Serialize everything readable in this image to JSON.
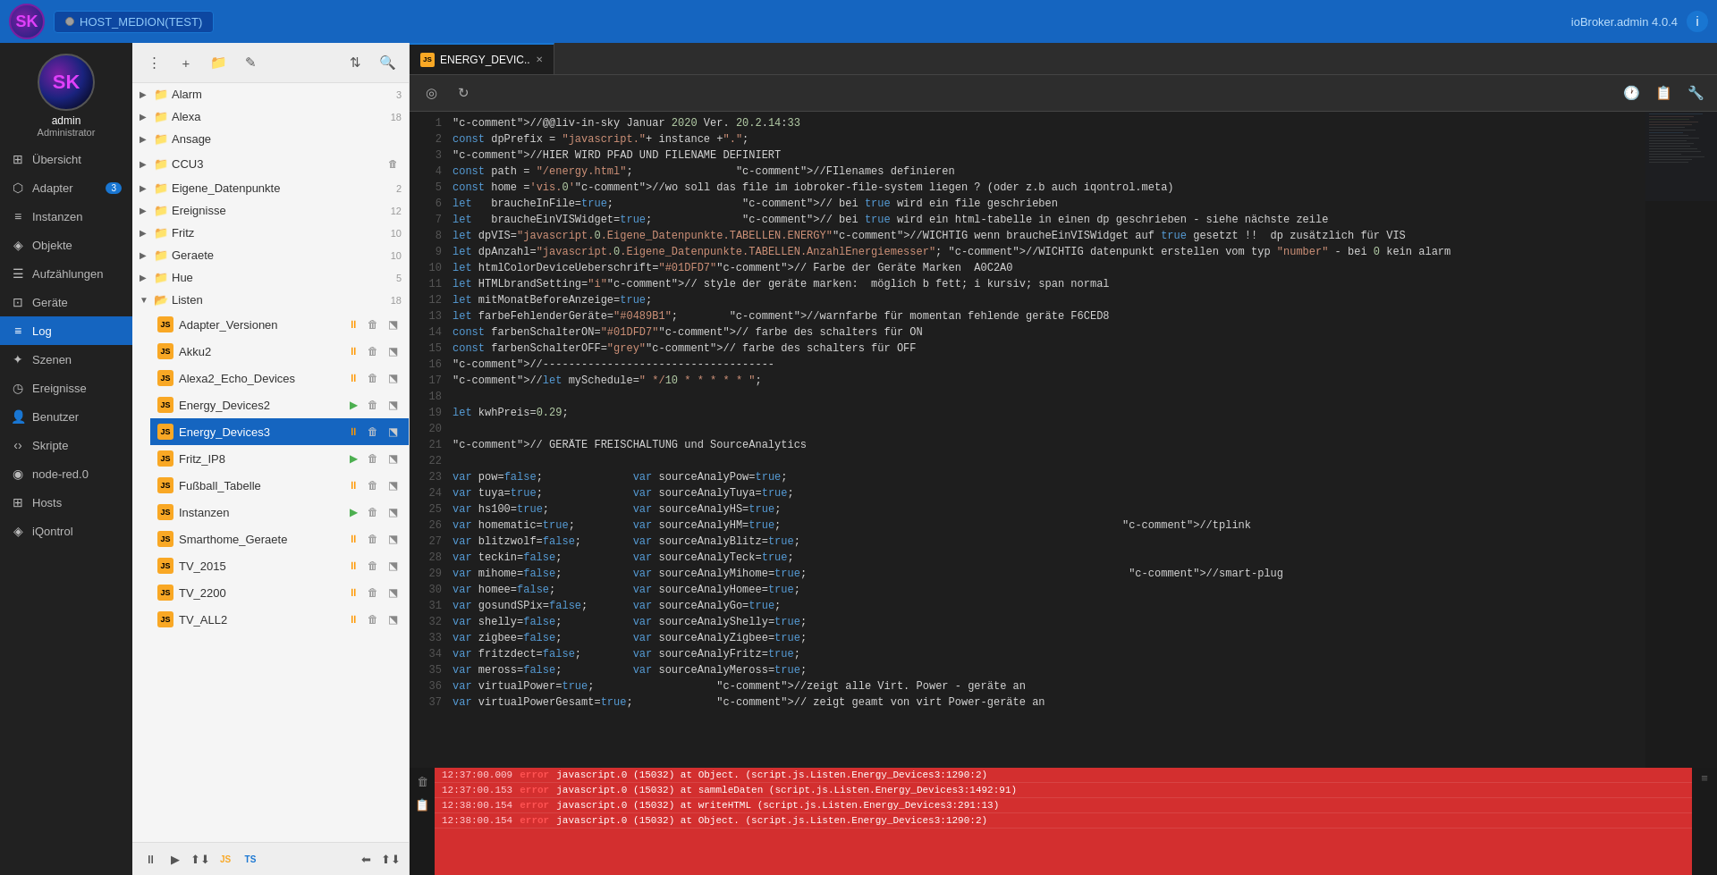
{
  "topbar": {
    "logo": "SK",
    "host_label": "HOST_MEDION(TEST)",
    "user_label": "ioBroker.admin 4.0.4",
    "icon_label": "i"
  },
  "sidebar": {
    "avatar_initials": "SK",
    "avatar_name": "admin",
    "avatar_role": "Administrator",
    "items": [
      {
        "id": "uebersicht",
        "label": "Übersicht",
        "icon": "⊞",
        "badge": null
      },
      {
        "id": "adapter",
        "label": "Adapter",
        "icon": "⬡",
        "badge": "3"
      },
      {
        "id": "instanzen",
        "label": "Instanzen",
        "icon": "≡",
        "badge": null
      },
      {
        "id": "objekte",
        "label": "Objekte",
        "icon": "◈",
        "badge": null
      },
      {
        "id": "aufzaehlungen",
        "label": "Aufzählungen",
        "icon": "☰",
        "badge": null
      },
      {
        "id": "geraete",
        "label": "Geräte",
        "icon": "⊡",
        "badge": null
      },
      {
        "id": "log",
        "label": "Log",
        "icon": "≡",
        "badge": null,
        "active": true
      },
      {
        "id": "szenen",
        "label": "Szenen",
        "icon": "✦",
        "badge": null
      },
      {
        "id": "ereignisse",
        "label": "Ereignisse",
        "icon": "◷",
        "badge": null
      },
      {
        "id": "benutzer",
        "label": "Benutzer",
        "icon": "👤",
        "badge": null
      },
      {
        "id": "skripte",
        "label": "Skripte",
        "icon": "‹›",
        "badge": null
      },
      {
        "id": "nodered",
        "label": "node-red.0",
        "icon": "◉",
        "badge": null
      },
      {
        "id": "hosts",
        "label": "Hosts",
        "icon": "⊞",
        "badge": null
      },
      {
        "id": "iqontrol",
        "label": "iQontrol",
        "icon": "◈",
        "badge": null
      }
    ]
  },
  "filetree": {
    "folders": [
      {
        "name": "Alarm",
        "count": "3",
        "expanded": false,
        "children": []
      },
      {
        "name": "Alexa",
        "count": "18",
        "expanded": false,
        "children": []
      },
      {
        "name": "Ansage",
        "count": "",
        "expanded": false,
        "children": []
      },
      {
        "name": "CCU3",
        "count": "",
        "expanded": false,
        "children": [],
        "has_delete": true
      },
      {
        "name": "Eigene_Datenpunkte",
        "count": "2",
        "expanded": false,
        "children": []
      },
      {
        "name": "Ereignisse",
        "count": "12",
        "expanded": false,
        "children": []
      },
      {
        "name": "Fritz",
        "count": "10",
        "expanded": false,
        "children": []
      },
      {
        "name": "Geraete",
        "count": "10",
        "expanded": false,
        "children": []
      },
      {
        "name": "Hue",
        "count": "5",
        "expanded": false,
        "children": []
      },
      {
        "name": "Listen",
        "count": "18",
        "expanded": true,
        "children": [
          {
            "name": "Adapter_Versionen",
            "type": "js",
            "status": "pause",
            "active": false
          },
          {
            "name": "Akku2",
            "type": "js",
            "status": "pause",
            "active": false
          },
          {
            "name": "Alexa2_Echo_Devices",
            "type": "js",
            "status": "pause",
            "active": false
          },
          {
            "name": "Energy_Devices2",
            "type": "js",
            "status": "play",
            "active": false
          },
          {
            "name": "Energy_Devices3",
            "type": "js",
            "status": "pause",
            "active": true
          },
          {
            "name": "Fritz_IP8",
            "type": "js",
            "status": "play",
            "active": false
          },
          {
            "name": "Fußball_Tabelle",
            "type": "js",
            "status": "pause",
            "active": false
          },
          {
            "name": "Instanzen",
            "type": "js",
            "status": "play",
            "active": false
          },
          {
            "name": "Smarthome_Geraete",
            "type": "js",
            "status": "pause",
            "active": false
          },
          {
            "name": "TV_2015",
            "type": "js",
            "status": "pause",
            "active": false
          },
          {
            "name": "TV_2200",
            "type": "js",
            "status": "pause",
            "active": false
          },
          {
            "name": "TV_ALL2",
            "type": "js",
            "status": "pause",
            "active": false
          }
        ]
      }
    ],
    "bottom_buttons": [
      "⏸",
      "▶",
      "⬆⬇",
      "JS",
      "TS"
    ]
  },
  "editor": {
    "tab_name": "ENERGY_DEVIC..",
    "toolbar_icons": [
      "◎",
      "↻"
    ],
    "right_icons": [
      "🕐",
      "📋",
      "🔧"
    ],
    "lines": [
      {
        "n": 1,
        "code": "//@@liv-in-sky Januar 2020 Ver. 20.2.14:33"
      },
      {
        "n": 2,
        "code": "const dpPrefix = \"javascript.\"+ instance +\".\";"
      },
      {
        "n": 3,
        "code": "    //HIER WIRD PFAD UND FILENAME DEFINIERT"
      },
      {
        "n": 4,
        "code": "const path = \"/energy.html\";                //FIlenames definieren"
      },
      {
        "n": 5,
        "code": "const home ='vis.0'                          //wo soll das file im iobroker-file-system liegen ? (oder z.b auch iqontrol.meta)"
      },
      {
        "n": 6,
        "code": "let   braucheInFile=true;                    // bei true wird ein file geschrieben"
      },
      {
        "n": 7,
        "code": "let   braucheEinVISWidget=true;              // bei true wird ein html-tabelle in einen dp geschrieben - siehe nächste zeile"
      },
      {
        "n": 8,
        "code": "let dpVIS=\"javascript.0.Eigene_Datenpunkte.TABELLEN.ENERGY\" //WICHTIG wenn braucheEinVISWidget auf true gesetzt !!  dp zusätzlich für VIS"
      },
      {
        "n": 9,
        "code": "let dpAnzahl=\"javascript.0.Eigene_Datenpunkte.TABELLEN.AnzahlEnergiemesser\"; //WICHTIG datenpunkt erstellen vom typ \"number\" - bei 0 kein alarm"
      },
      {
        "n": 10,
        "code": "let htmlColorDeviceUeberschrift=\"#01DFD7\"  // Farbe der Geräte Marken  A0C2A0"
      },
      {
        "n": 11,
        "code": "let HTMLbrandSetting=\"i\"                   // style der geräte marken:  möglich b fett; i kursiv; span normal"
      },
      {
        "n": 12,
        "code": "let mitMonatBeforeAnzeige=true;"
      },
      {
        "n": 13,
        "code": "let farbeFehlenderGeräte=\"#0489B1\";        //warnfarbe für momentan fehlende geräte F6CED8"
      },
      {
        "n": 14,
        "code": "const farbenSchalterON=\"#01DFD7\"           // farbe des schalters für ON"
      },
      {
        "n": 15,
        "code": "const farbenSchalterOFF=\"grey\"             // farbe des schalters für OFF"
      },
      {
        "n": 16,
        "code": "//------------------------------------"
      },
      {
        "n": 17,
        "code": "//let mySchedule=\" */10 * * * * * \";"
      },
      {
        "n": 18,
        "code": ""
      },
      {
        "n": 19,
        "code": "let kwhPreis=0.29;"
      },
      {
        "n": 20,
        "code": ""
      },
      {
        "n": 21,
        "code": "// GERÄTE FREISCHALTUNG und SourceAnalytics"
      },
      {
        "n": 22,
        "code": ""
      },
      {
        "n": 23,
        "code": "var pow=false;              var sourceAnalyPow=true;"
      },
      {
        "n": 24,
        "code": "var tuya=true;              var sourceAnalyTuya=true;"
      },
      {
        "n": 25,
        "code": "var hs100=true;             var sourceAnalyHS=true;"
      },
      {
        "n": 26,
        "code": "var homematic=true;         var sourceAnalyHM=true;                                                     //tplink"
      },
      {
        "n": 27,
        "code": "var blitzwolf=false;        var sourceAnalyBlitz=true;"
      },
      {
        "n": 28,
        "code": "var teckin=false;           var sourceAnalyTeck=true;"
      },
      {
        "n": 29,
        "code": "var mihome=false;           var sourceAnalyMihome=true;                                                  //smart-plug"
      },
      {
        "n": 30,
        "code": "var homee=false;            var sourceAnalyHomee=true;"
      },
      {
        "n": 31,
        "code": "var gosundSPix=false;       var sourceAnalyGo=true;"
      },
      {
        "n": 32,
        "code": "var shelly=false;           var sourceAnalyShelly=true;"
      },
      {
        "n": 33,
        "code": "var zigbee=false;           var sourceAnalyZigbee=true;"
      },
      {
        "n": 34,
        "code": "var fritzdect=false;        var sourceAnalyFritz=true;"
      },
      {
        "n": 35,
        "code": "var meross=false;           var sourceAnalyMeross=true;"
      },
      {
        "n": 36,
        "code": "var virtualPower=true;                   //zeigt alle Virt. Power - geräte an"
      },
      {
        "n": 37,
        "code": "var virtualPowerGesamt=true;             // zeigt geamt von virt Power-geräte an"
      }
    ]
  },
  "log": {
    "entries": [
      {
        "time": "12:37:00.009",
        "level": "error",
        "text": "javascript.0 (15032) at Object.<anonymous> (script.js.Listen.Energy_Devices3:1290:2)"
      },
      {
        "time": "12:37:00.153",
        "level": "error",
        "text": "javascript.0 (15032) at sammleDaten (script.js.Listen.Energy_Devices3:1492:91)"
      },
      {
        "time": "12:38:00.154",
        "level": "error",
        "text": "javascript.0 (15032) at writeHTML (script.js.Listen.Energy_Devices3:291:13)"
      },
      {
        "time": "12:38:00.154",
        "level": "error",
        "text": "javascript.0 (15032) at Object.<anonymous> (script.js.Listen.Energy_Devices3:1290:2)"
      }
    ]
  }
}
